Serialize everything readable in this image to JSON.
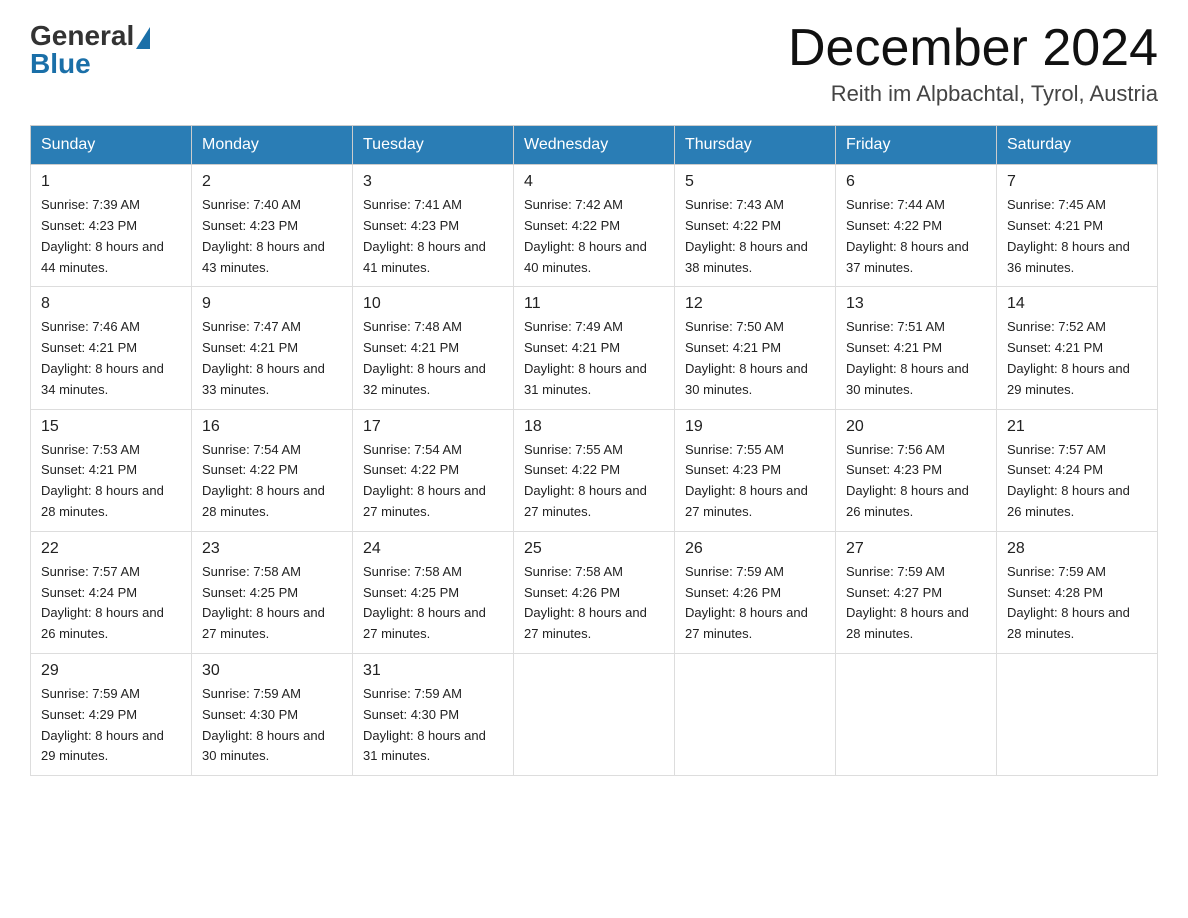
{
  "header": {
    "title": "December 2024",
    "location": "Reith im Alpbachtal, Tyrol, Austria",
    "logo_general": "General",
    "logo_blue": "Blue"
  },
  "days_of_week": [
    "Sunday",
    "Monday",
    "Tuesday",
    "Wednesday",
    "Thursday",
    "Friday",
    "Saturday"
  ],
  "weeks": [
    [
      {
        "day": "1",
        "sunrise": "7:39 AM",
        "sunset": "4:23 PM",
        "daylight": "8 hours and 44 minutes."
      },
      {
        "day": "2",
        "sunrise": "7:40 AM",
        "sunset": "4:23 PM",
        "daylight": "8 hours and 43 minutes."
      },
      {
        "day": "3",
        "sunrise": "7:41 AM",
        "sunset": "4:23 PM",
        "daylight": "8 hours and 41 minutes."
      },
      {
        "day": "4",
        "sunrise": "7:42 AM",
        "sunset": "4:22 PM",
        "daylight": "8 hours and 40 minutes."
      },
      {
        "day": "5",
        "sunrise": "7:43 AM",
        "sunset": "4:22 PM",
        "daylight": "8 hours and 38 minutes."
      },
      {
        "day": "6",
        "sunrise": "7:44 AM",
        "sunset": "4:22 PM",
        "daylight": "8 hours and 37 minutes."
      },
      {
        "day": "7",
        "sunrise": "7:45 AM",
        "sunset": "4:21 PM",
        "daylight": "8 hours and 36 minutes."
      }
    ],
    [
      {
        "day": "8",
        "sunrise": "7:46 AM",
        "sunset": "4:21 PM",
        "daylight": "8 hours and 34 minutes."
      },
      {
        "day": "9",
        "sunrise": "7:47 AM",
        "sunset": "4:21 PM",
        "daylight": "8 hours and 33 minutes."
      },
      {
        "day": "10",
        "sunrise": "7:48 AM",
        "sunset": "4:21 PM",
        "daylight": "8 hours and 32 minutes."
      },
      {
        "day": "11",
        "sunrise": "7:49 AM",
        "sunset": "4:21 PM",
        "daylight": "8 hours and 31 minutes."
      },
      {
        "day": "12",
        "sunrise": "7:50 AM",
        "sunset": "4:21 PM",
        "daylight": "8 hours and 30 minutes."
      },
      {
        "day": "13",
        "sunrise": "7:51 AM",
        "sunset": "4:21 PM",
        "daylight": "8 hours and 30 minutes."
      },
      {
        "day": "14",
        "sunrise": "7:52 AM",
        "sunset": "4:21 PM",
        "daylight": "8 hours and 29 minutes."
      }
    ],
    [
      {
        "day": "15",
        "sunrise": "7:53 AM",
        "sunset": "4:21 PM",
        "daylight": "8 hours and 28 minutes."
      },
      {
        "day": "16",
        "sunrise": "7:54 AM",
        "sunset": "4:22 PM",
        "daylight": "8 hours and 28 minutes."
      },
      {
        "day": "17",
        "sunrise": "7:54 AM",
        "sunset": "4:22 PM",
        "daylight": "8 hours and 27 minutes."
      },
      {
        "day": "18",
        "sunrise": "7:55 AM",
        "sunset": "4:22 PM",
        "daylight": "8 hours and 27 minutes."
      },
      {
        "day": "19",
        "sunrise": "7:55 AM",
        "sunset": "4:23 PM",
        "daylight": "8 hours and 27 minutes."
      },
      {
        "day": "20",
        "sunrise": "7:56 AM",
        "sunset": "4:23 PM",
        "daylight": "8 hours and 26 minutes."
      },
      {
        "day": "21",
        "sunrise": "7:57 AM",
        "sunset": "4:24 PM",
        "daylight": "8 hours and 26 minutes."
      }
    ],
    [
      {
        "day": "22",
        "sunrise": "7:57 AM",
        "sunset": "4:24 PM",
        "daylight": "8 hours and 26 minutes."
      },
      {
        "day": "23",
        "sunrise": "7:58 AM",
        "sunset": "4:25 PM",
        "daylight": "8 hours and 27 minutes."
      },
      {
        "day": "24",
        "sunrise": "7:58 AM",
        "sunset": "4:25 PM",
        "daylight": "8 hours and 27 minutes."
      },
      {
        "day": "25",
        "sunrise": "7:58 AM",
        "sunset": "4:26 PM",
        "daylight": "8 hours and 27 minutes."
      },
      {
        "day": "26",
        "sunrise": "7:59 AM",
        "sunset": "4:26 PM",
        "daylight": "8 hours and 27 minutes."
      },
      {
        "day": "27",
        "sunrise": "7:59 AM",
        "sunset": "4:27 PM",
        "daylight": "8 hours and 28 minutes."
      },
      {
        "day": "28",
        "sunrise": "7:59 AM",
        "sunset": "4:28 PM",
        "daylight": "8 hours and 28 minutes."
      }
    ],
    [
      {
        "day": "29",
        "sunrise": "7:59 AM",
        "sunset": "4:29 PM",
        "daylight": "8 hours and 29 minutes."
      },
      {
        "day": "30",
        "sunrise": "7:59 AM",
        "sunset": "4:30 PM",
        "daylight": "8 hours and 30 minutes."
      },
      {
        "day": "31",
        "sunrise": "7:59 AM",
        "sunset": "4:30 PM",
        "daylight": "8 hours and 31 minutes."
      },
      null,
      null,
      null,
      null
    ]
  ]
}
